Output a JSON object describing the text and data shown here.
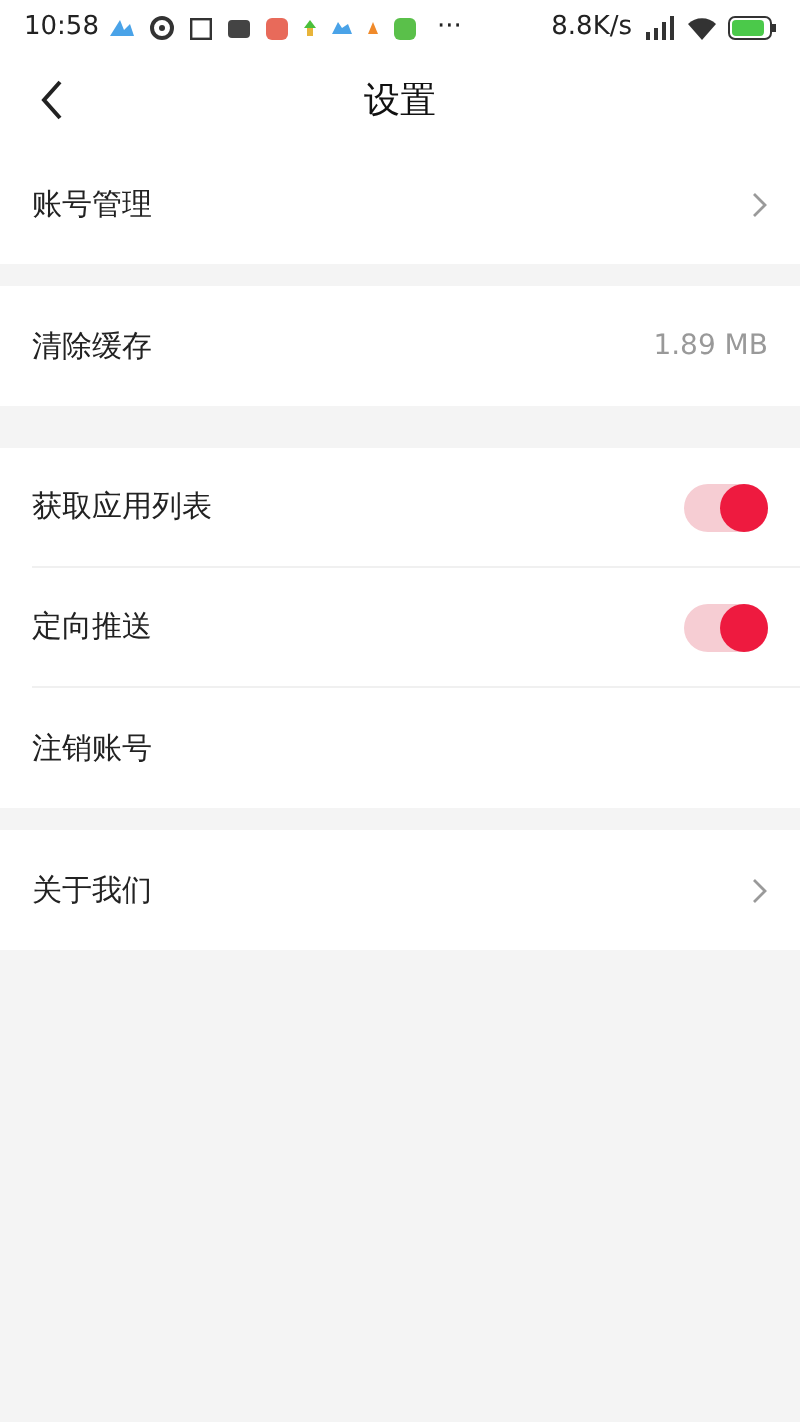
{
  "status_bar": {
    "time": "10:58",
    "more": "···",
    "speed": "8.8K/s"
  },
  "header": {
    "title": "设置"
  },
  "groups": [
    {
      "items": [
        {
          "kind": "chevron",
          "label": "账号管理"
        }
      ]
    },
    {
      "items": [
        {
          "kind": "value",
          "label": "清除缓存",
          "value": "1.89 MB"
        }
      ]
    },
    {
      "items": [
        {
          "kind": "toggle",
          "label": "获取应用列表",
          "on": true
        },
        {
          "kind": "toggle",
          "label": "定向推送",
          "on": true
        },
        {
          "kind": "plain",
          "label": "注销账号"
        }
      ]
    },
    {
      "items": [
        {
          "kind": "chevron",
          "label": "关于我们"
        }
      ]
    }
  ]
}
